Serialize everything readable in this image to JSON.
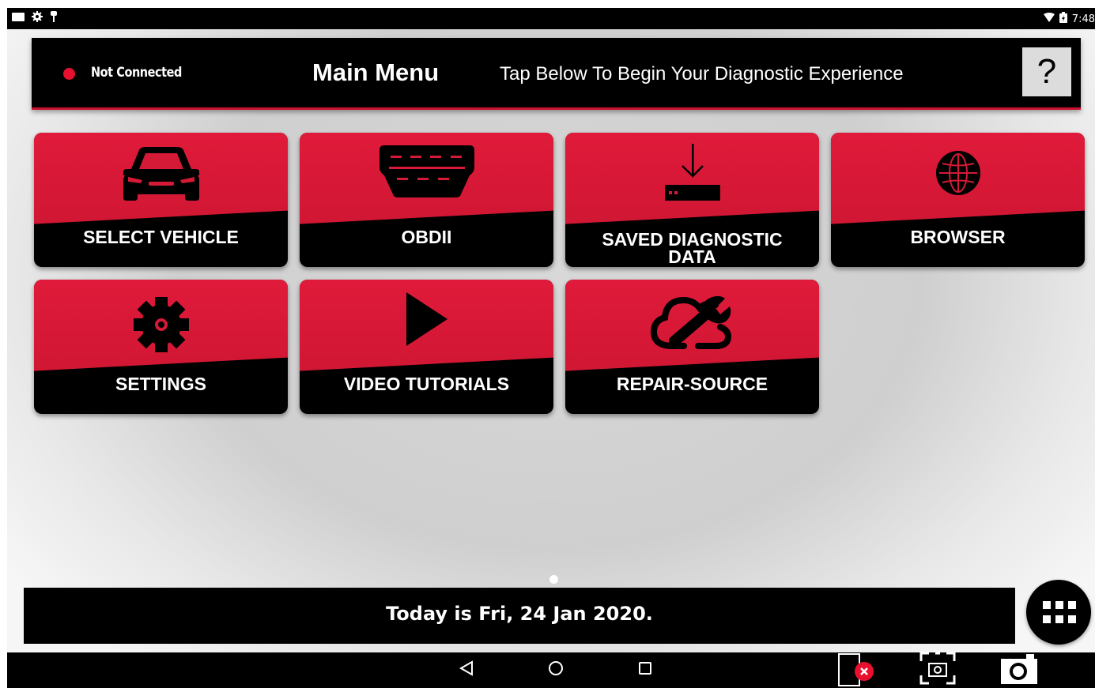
{
  "status_bar": {
    "left_icons": [
      "keyboard-icon",
      "settings-icon",
      "usb-icon"
    ],
    "right_icons": [
      "wifi-icon",
      "battery-icon"
    ],
    "time": "7:48"
  },
  "header": {
    "connection_status": "Not Connected",
    "connection_color": "#e8102e",
    "title": "Main Menu",
    "subtitle": "Tap Below To Begin Your Diagnostic Experience",
    "help_label": "?"
  },
  "tiles": [
    {
      "label": "SELECT VEHICLE",
      "icon": "car-icon"
    },
    {
      "label": "OBDII",
      "icon": "obd-connector-icon"
    },
    {
      "label": "SAVED DIAGNOSTIC",
      "label2": "DATA",
      "icon": "download-icon"
    },
    {
      "label": "BROWSER",
      "icon": "globe-icon"
    },
    {
      "label": "SETTINGS",
      "icon": "gear-icon"
    },
    {
      "label": "VIDEO TUTORIALS",
      "icon": "play-icon"
    },
    {
      "label": "REPAIR-SOURCE",
      "icon": "cloud-wrench-icon"
    }
  ],
  "date_bar": {
    "text": "Today is Fri, 24 Jan 2020."
  },
  "colors": {
    "accent_red": "#d41a36",
    "background": "#d2d2d2",
    "bar": "#000000"
  },
  "nav_bar": {
    "buttons": [
      "back-icon",
      "home-icon",
      "recents-icon"
    ],
    "right_tools": [
      "disconnect-icon",
      "screenshot-region-icon",
      "camera-icon"
    ]
  }
}
